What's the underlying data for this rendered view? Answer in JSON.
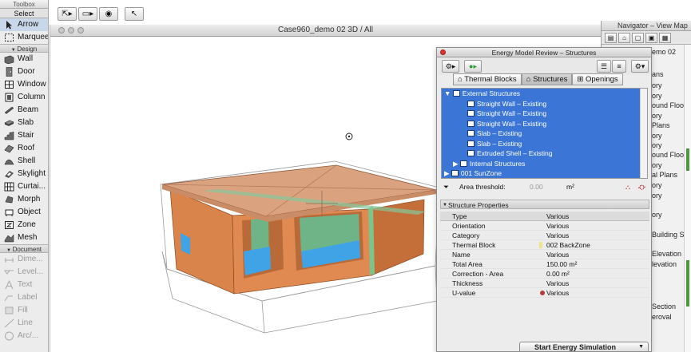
{
  "toolbox": {
    "title": "Toolbox",
    "select_label": "Select",
    "tools_top": [
      {
        "label": "Arrow",
        "icon": "arrow-icon"
      },
      {
        "label": "Marquee",
        "icon": "marquee-icon"
      }
    ],
    "design_header": "Design",
    "design_tools": [
      {
        "label": "Wall",
        "icon": "wall-icon"
      },
      {
        "label": "Door",
        "icon": "door-icon"
      },
      {
        "label": "Window",
        "icon": "window-icon"
      },
      {
        "label": "Column",
        "icon": "column-icon"
      },
      {
        "label": "Beam",
        "icon": "beam-icon"
      },
      {
        "label": "Slab",
        "icon": "slab-icon"
      },
      {
        "label": "Stair",
        "icon": "stair-icon"
      },
      {
        "label": "Roof",
        "icon": "roof-icon"
      },
      {
        "label": "Shell",
        "icon": "shell-icon"
      },
      {
        "label": "Skylight",
        "icon": "skylight-icon"
      },
      {
        "label": "Curtai...",
        "icon": "curtain-wall-icon"
      },
      {
        "label": "Morph",
        "icon": "morph-icon"
      },
      {
        "label": "Object",
        "icon": "object-icon"
      },
      {
        "label": "Zone",
        "icon": "zone-icon"
      },
      {
        "label": "Mesh",
        "icon": "mesh-icon"
      }
    ],
    "document_header": "Document",
    "document_tools": [
      {
        "label": "Dime...",
        "icon": "dimension-icon"
      },
      {
        "label": "Level...",
        "icon": "level-dimension-icon"
      },
      {
        "label": "Text",
        "icon": "text-icon"
      },
      {
        "label": "Label",
        "icon": "label-icon"
      },
      {
        "label": "Fill",
        "icon": "fill-icon"
      },
      {
        "label": "Line",
        "icon": "line-icon"
      },
      {
        "label": "Arc/...",
        "icon": "arc-icon"
      }
    ]
  },
  "window3d": {
    "title": "Case960_demo 02 3D / All"
  },
  "navigator": {
    "title": "Navigator – View Map",
    "rows": [
      "emo 02",
      "ans",
      "ory",
      "ory",
      "ound Floo",
      "ory",
      "Plans",
      "ory",
      "ory",
      "ound Floo",
      "ory",
      "al Plans",
      "ory",
      "ory",
      "ory",
      "Building S",
      "Elevation",
      "levation",
      "Section",
      "eroval"
    ]
  },
  "energy_panel": {
    "title": "Energy Model Review – Structures",
    "tabs": [
      "Thermal Blocks",
      "Structures",
      "Openings"
    ],
    "tree": [
      {
        "label": "External Structures",
        "indent": 1,
        "selected": true
      },
      {
        "label": "Straight Wall – Existing",
        "indent": 3,
        "selected": true
      },
      {
        "label": "Straight Wall – Existing",
        "indent": 3,
        "selected": true
      },
      {
        "label": "Straight Wall – Existing",
        "indent": 3,
        "selected": true
      },
      {
        "label": "Slab – Existing",
        "indent": 3,
        "selected": true
      },
      {
        "label": "Slab – Existing",
        "indent": 3,
        "selected": true
      },
      {
        "label": "Extruded Shell – Existing",
        "indent": 3,
        "selected": true
      },
      {
        "label": "Internal Structures",
        "indent": 1,
        "selected": true
      },
      {
        "label": "001 SunZone",
        "indent": 0,
        "selected": true
      }
    ],
    "area_threshold_label": "Area threshold:",
    "area_threshold_value": "0.00",
    "area_unit": "m²",
    "section_title": "Structure Properties",
    "properties": [
      {
        "key": "Type",
        "value": "Various"
      },
      {
        "key": "Orientation",
        "value": "Various"
      },
      {
        "key": "Category",
        "value": "Various"
      },
      {
        "key": "Thermal Block",
        "value": "002 BackZone"
      },
      {
        "key": "Name",
        "value": "Various"
      },
      {
        "key": "Total Area",
        "value": "150.00 m²"
      },
      {
        "key": "Correction - Area",
        "value": "0.00 m²"
      },
      {
        "key": "Thickness",
        "value": "Various"
      },
      {
        "key": "U-value",
        "value": "Various"
      }
    ],
    "start_button": "Start Energy Simulation"
  },
  "colors": {
    "selection_blue": "#3b76d6",
    "wall_orange": "#d8844b",
    "roof_tan": "#dba27f",
    "glass_blue": "#3fa3e6",
    "glass_green": "#6fb487"
  }
}
